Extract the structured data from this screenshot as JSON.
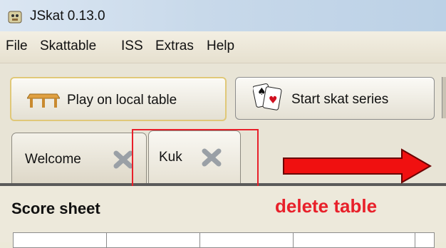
{
  "window": {
    "title": "JSkat 0.13.0"
  },
  "menu": {
    "items": [
      "File",
      "Skattable",
      "ISS",
      "Extras",
      "Help"
    ]
  },
  "toolbar": {
    "play_local_label": "Play on local table",
    "start_series_label": "Start skat series"
  },
  "tabs": [
    {
      "label": "Welcome",
      "closable": true,
      "active": false
    },
    {
      "label": "Kuk",
      "closable": true,
      "active": true
    }
  ],
  "content": {
    "score_sheet_title": "Score sheet"
  },
  "annotation": {
    "text": "delete table",
    "color": "#e8202a"
  },
  "icons": {
    "app": "jskat-app-icon",
    "play_local": "table-icon",
    "start_series": "playing-cards-icon",
    "tab_close": "close-x-icon",
    "arrow": "right-arrow-icon"
  }
}
